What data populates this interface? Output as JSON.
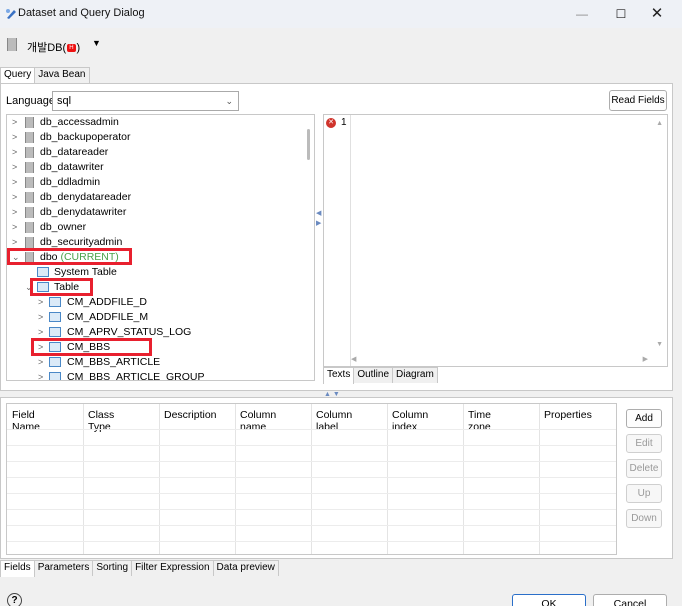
{
  "window": {
    "title": "Dataset and Query Dialog",
    "minimize_glyph": "—",
    "maximize_glyph": "☐",
    "close_glyph": "✕"
  },
  "datasource": {
    "name_prefix": "개발DB(",
    "badge": "H",
    "name_suffix": ")",
    "dropdown_glyph": "▼"
  },
  "top_tabs": [
    "Query",
    "Java Bean"
  ],
  "language": {
    "label": "Language",
    "value": "sql"
  },
  "read_fields_label": "Read Fields",
  "tree": {
    "items": [
      {
        "label": "db_accessadmin"
      },
      {
        "label": "db_backupoperator"
      },
      {
        "label": "db_datareader"
      },
      {
        "label": "db_datawriter"
      },
      {
        "label": "db_ddladmin"
      },
      {
        "label": "db_denydatareader"
      },
      {
        "label": "db_denydatawriter"
      },
      {
        "label": "db_owner"
      },
      {
        "label": "db_securityadmin"
      },
      {
        "label": "dbo",
        "suffix": "(CURRENT)"
      },
      {
        "label": "System Table"
      },
      {
        "label": "Table"
      },
      {
        "label": "CM_ADDFILE_D"
      },
      {
        "label": "CM_ADDFILE_M"
      },
      {
        "label": "CM_APRV_STATUS_LOG"
      },
      {
        "label": "CM_BBS"
      },
      {
        "label": "CM_BBS_ARTICLE"
      },
      {
        "label": "CM_BBS_ARTICLE_GROUP"
      }
    ]
  },
  "editor": {
    "line_number": "1",
    "content": ""
  },
  "editor_tabs": [
    "Texts",
    "Outline",
    "Diagram"
  ],
  "fields_table": {
    "columns": [
      "Field Name",
      "Class Type",
      "Description",
      "Column name",
      "Column label",
      "Column index",
      "Time zone",
      "Properties"
    ]
  },
  "field_buttons": {
    "add": "Add",
    "edit": "Edit",
    "delete": "Delete",
    "up": "Up",
    "down": "Down"
  },
  "bottom_tabs": [
    "Fields",
    "Parameters",
    "Sorting",
    "Filter Expression",
    "Data preview"
  ],
  "dialog_buttons": {
    "help": "?",
    "ok": "OK",
    "cancel": "Cancel"
  },
  "colors": {
    "highlight_box": "#e8202e",
    "current_tag": "#4aa24a",
    "ok_border": "#2a6fc9"
  }
}
